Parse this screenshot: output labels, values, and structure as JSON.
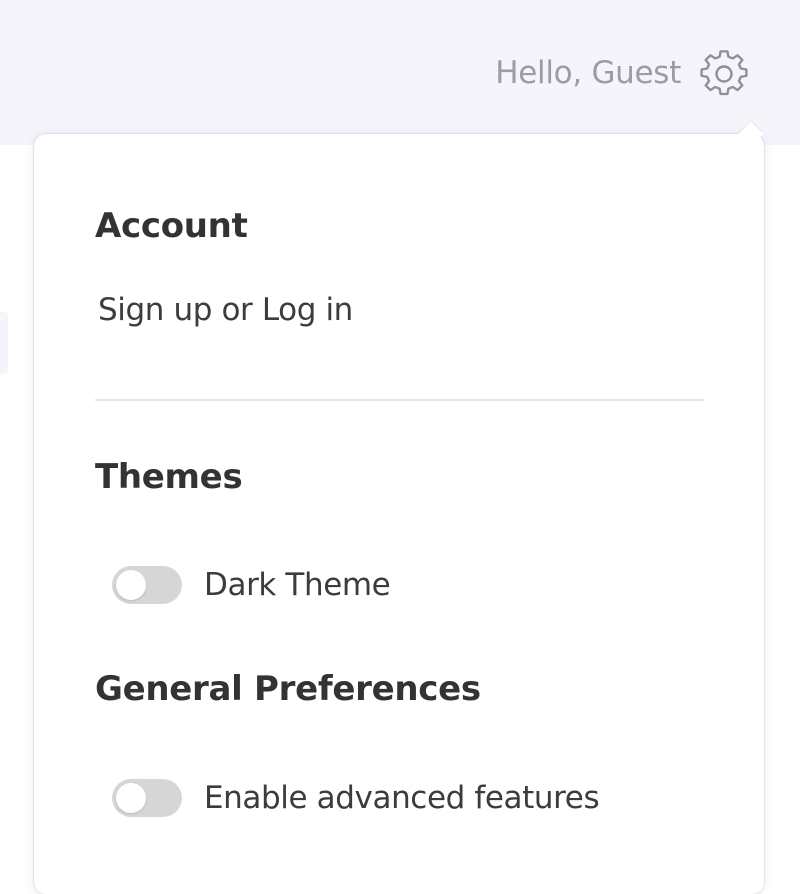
{
  "header": {
    "greeting": "Hello, Guest",
    "settings_icon": "gear-icon"
  },
  "menu": {
    "account": {
      "title": "Account",
      "link": "Sign up or Log in"
    },
    "themes": {
      "title": "Themes",
      "options": [
        {
          "label": "Dark Theme",
          "enabled": false
        }
      ]
    },
    "general_preferences": {
      "title": "General Preferences",
      "options": [
        {
          "label": "Enable advanced features",
          "enabled": false
        }
      ]
    }
  },
  "colors": {
    "header_background": "#f5f4fb",
    "toggle_off": "#d6d6d6",
    "heading_text": "#333333",
    "body_text": "#3c3c3c",
    "muted_text": "#9c9ca3"
  }
}
